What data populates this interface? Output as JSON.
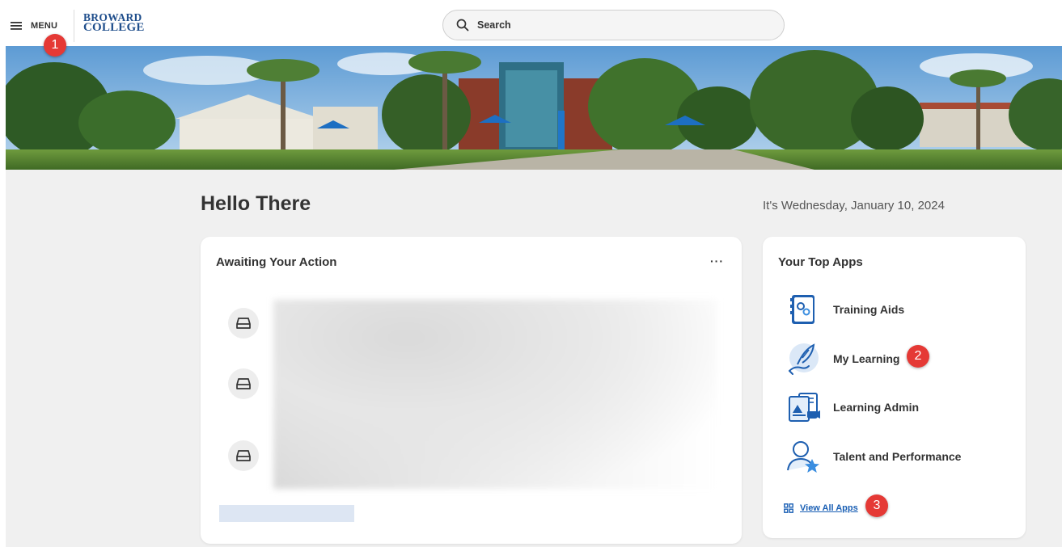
{
  "header": {
    "menu_label": "MENU",
    "logo_line1": "BROWARD",
    "logo_line2": "COLLEGE",
    "search_placeholder": "Search"
  },
  "annotations": [
    "1",
    "2",
    "3"
  ],
  "greeting": "Hello There",
  "date_text": "It's Wednesday, January 10, 2024",
  "awaiting": {
    "title": "Awaiting Your Action",
    "more_label": "···"
  },
  "top_apps": {
    "title": "Your Top Apps",
    "items": [
      {
        "label": "Training Aids",
        "icon": "training-aids-icon"
      },
      {
        "label": "My Learning",
        "icon": "my-learning-icon"
      },
      {
        "label": "Learning Admin",
        "icon": "learning-admin-icon"
      },
      {
        "label": "Talent and Performance",
        "icon": "talent-performance-icon"
      }
    ],
    "view_all_label": "View All Apps"
  },
  "colors": {
    "accent": "#1a5fb4",
    "logo": "#1f4e8c",
    "badge": "#e53935",
    "background": "#f0f0f0"
  }
}
